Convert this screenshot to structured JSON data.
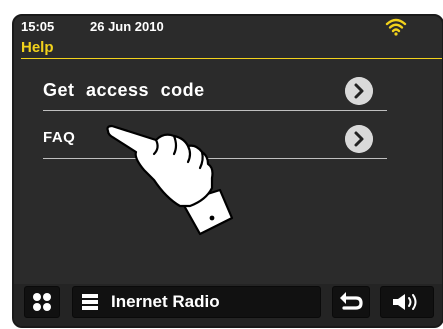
{
  "status": {
    "time": "15:05",
    "date": "26 Jun 2010",
    "wifi_icon": "wifi-icon",
    "wifi_color": "#f2d21c"
  },
  "header": {
    "title": "Help",
    "title_color": "#f2d21c"
  },
  "menu": {
    "items": [
      {
        "label": "Get  access  code",
        "icon": "chevron-right-icon"
      },
      {
        "label": "FAQ",
        "icon": "chevron-right-icon"
      }
    ]
  },
  "footer": {
    "menu_icon": "grid-icon",
    "source_icon": "list-icon",
    "source_label": "Inernet  Radio",
    "back_icon": "back-arrow-icon",
    "volume_icon": "volume-icon"
  }
}
